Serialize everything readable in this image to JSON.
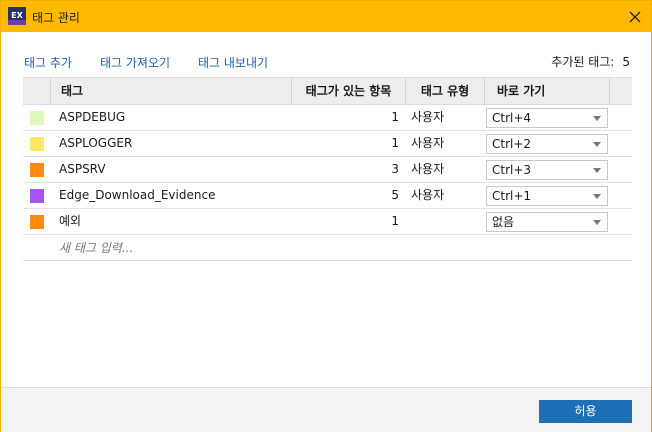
{
  "window": {
    "title": "태그 관리",
    "app_icon_label": "EX",
    "close_icon": "close-icon"
  },
  "toolbar": {
    "add_tag": "태그 추가",
    "import_tags": "태그 가져오기",
    "export_tags": "태그 내보내기",
    "added_tags_label": "추가된 태그:",
    "added_tags_count": "5"
  },
  "table": {
    "columns": [
      "태그",
      "태그가 있는 항목",
      "태그 유형",
      "바로 가기"
    ],
    "rows": [
      {
        "color": "#ddf9c0",
        "name": "ASPDEBUG",
        "count": "1",
        "type": "사용자",
        "shortcut": "Ctrl+4"
      },
      {
        "color": "#ffe866",
        "name": "ASPLOGGER",
        "count": "1",
        "type": "사용자",
        "shortcut": "Ctrl+2"
      },
      {
        "color": "#ff8a14",
        "name": "ASPSRV",
        "count": "3",
        "type": "사용자",
        "shortcut": "Ctrl+3"
      },
      {
        "color": "#a855f7",
        "name": "Edge_Download_Evidence",
        "count": "5",
        "type": "사용자",
        "shortcut": "Ctrl+1"
      },
      {
        "color": "#ff8a14",
        "name": "예외",
        "count": "1",
        "type": "",
        "shortcut": "없음"
      }
    ],
    "new_tag_placeholder": "새 태그 입력..."
  },
  "footer": {
    "ok_label": "허용"
  },
  "colors": {
    "titlebar": "#ffba00",
    "link": "#1f5fa8",
    "primary_button": "#1e6fb5"
  }
}
